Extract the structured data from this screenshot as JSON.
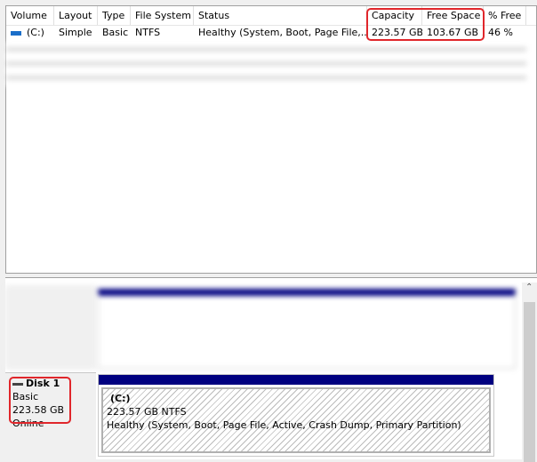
{
  "volume_list": {
    "columns": [
      "Volume",
      "Layout",
      "Type",
      "File System",
      "Status",
      "Capacity",
      "Free Space",
      "% Free"
    ],
    "rows": [
      {
        "volume": "(C:)",
        "layout": "Simple",
        "type": "Basic",
        "fs": "NTFS",
        "status": "Healthy (System, Boot, Page File,...",
        "capacity": "223.57 GB",
        "free": "103.67 GB",
        "pct": "46 %"
      }
    ]
  },
  "disk1": {
    "name": "Disk 1",
    "type": "Basic",
    "size": "223.58 GB",
    "state": "Online",
    "partition": {
      "label": "(C:)",
      "size_fs": "223.57 GB NTFS",
      "status": "Healthy (System, Boot, Page File, Active, Crash Dump, Primary Partition)"
    }
  },
  "colors": {
    "highlight": "#e0262b",
    "partition_bar": "#000080"
  }
}
